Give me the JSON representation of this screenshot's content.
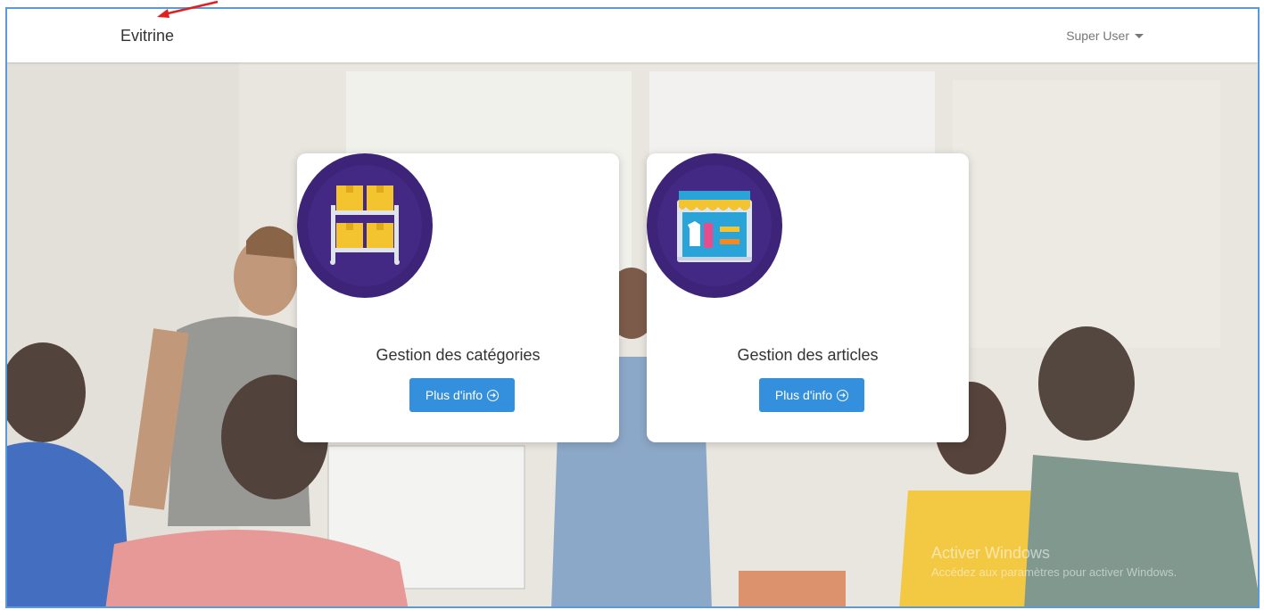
{
  "navbar": {
    "brand": "Evitrine",
    "user": "Super User"
  },
  "cards": [
    {
      "title": "Gestion des catégories",
      "button": "Plus d'info",
      "icon": "shelf-boxes-icon"
    },
    {
      "title": "Gestion des articles",
      "button": "Plus d'info",
      "icon": "shop-storefront-icon"
    }
  ],
  "watermark": {
    "title": "Activer Windows",
    "subtitle": "Accédez aux paramètres pour activer Windows."
  },
  "colors": {
    "button": "#3490dc",
    "icon_circle": "#3d2479",
    "annotation": "#e02020"
  }
}
